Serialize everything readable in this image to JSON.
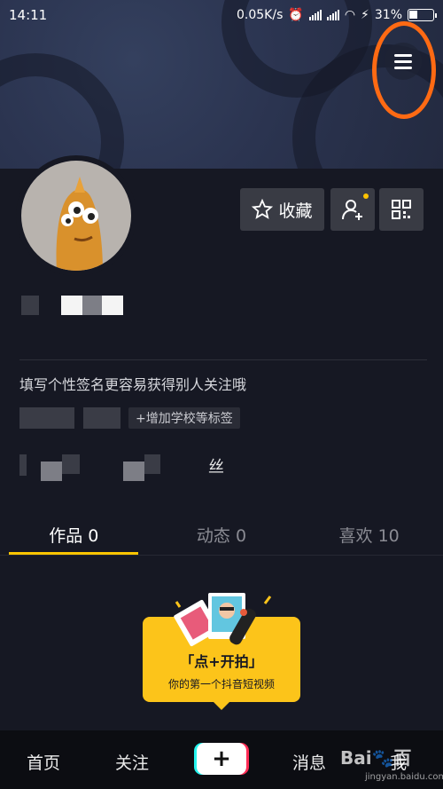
{
  "status_bar": {
    "time": "14:11",
    "network_speed": "0.05K/s",
    "battery": "31%"
  },
  "profile": {
    "favorite_label": "收藏",
    "signature": "填写个性签名更容易获得别人关注哦",
    "school_tag": "+增加学校等标签",
    "stats_visible_char": "丝"
  },
  "tabs": [
    {
      "label": "作品 0"
    },
    {
      "label": "动态 0"
    },
    {
      "label": "喜欢 10"
    }
  ],
  "shoot_card": {
    "title": "「点+开拍」",
    "subtitle": "你的第一个抖音短视频"
  },
  "bottom_nav": {
    "home": "首页",
    "follow": "关注",
    "plus": "+",
    "messages": "消息",
    "me": "我"
  },
  "watermark": {
    "text": "Bai🐾百",
    "sub": "jingyan.baidu.com"
  },
  "colors": {
    "accent": "#fdc500",
    "highlight_ring": "#ff6a13",
    "background": "#161823"
  }
}
